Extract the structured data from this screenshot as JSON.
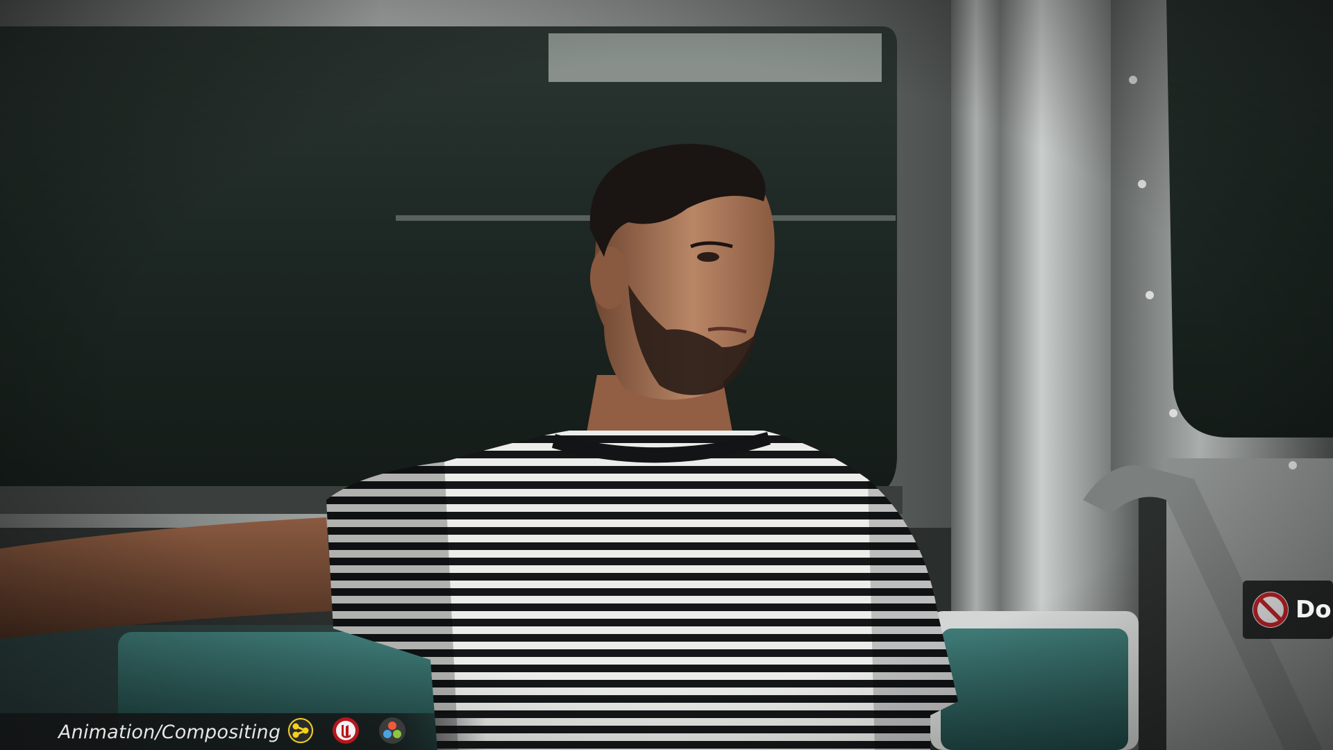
{
  "overlay": {
    "category_label": "Animation/Compositing",
    "tool_icons": [
      {
        "name": "node-graph-logo-icon",
        "color": "#f4d21c"
      },
      {
        "name": "unreal-engine-logo-icon",
        "color": "#b8161c"
      },
      {
        "name": "davinci-resolve-logo-icon",
        "color": "#4aa3df"
      }
    ]
  },
  "scene": {
    "sign_text": "Do",
    "colors": {
      "window_dark": "#1b2420",
      "steel": "#8d9190",
      "seat_teal": "#2f6a66",
      "skin": "#b07a5c",
      "hair": "#1a1412",
      "stripe_dark": "#141618",
      "stripe_light": "#e9ebea"
    }
  }
}
